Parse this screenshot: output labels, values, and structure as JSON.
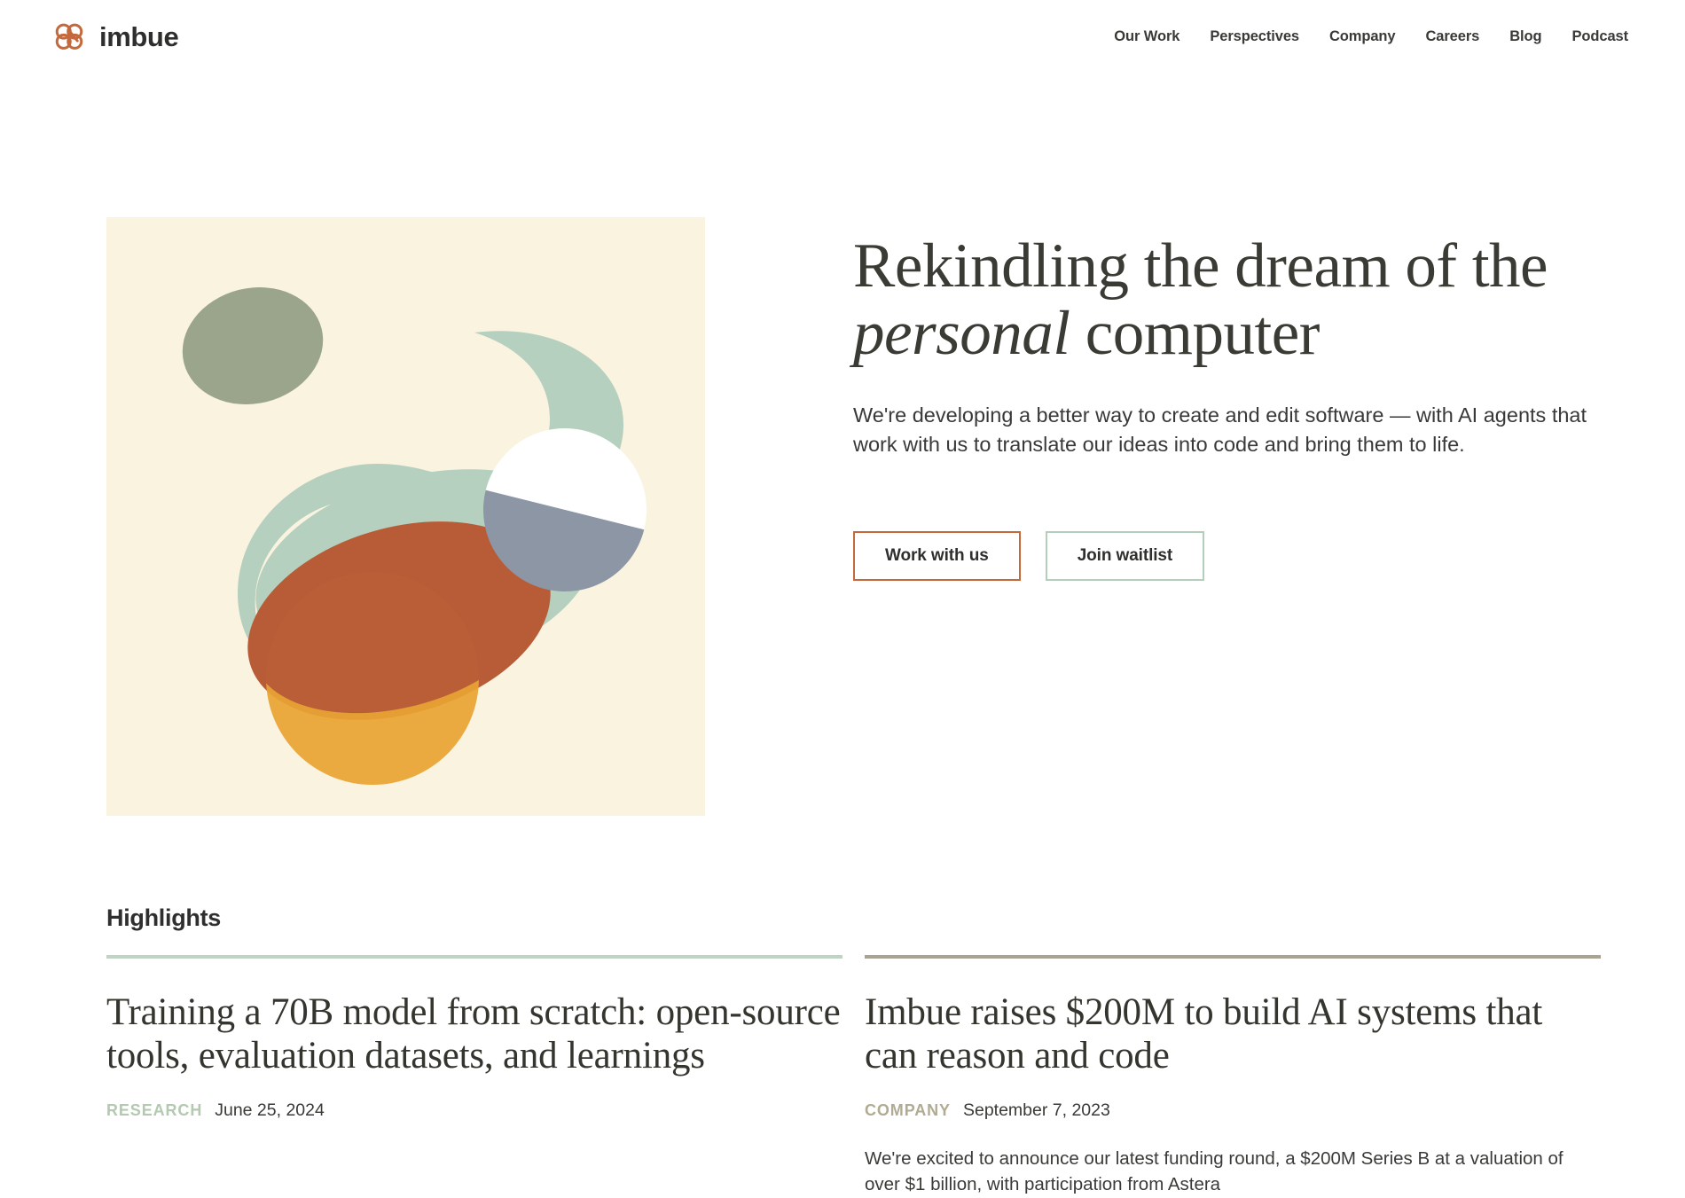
{
  "header": {
    "brand_name": "imbue",
    "brand_mark_icon": "imbue-interlocking-rings-logo",
    "brand_color": "#c4693c",
    "nav": [
      {
        "label": "Our Work"
      },
      {
        "label": "Perspectives"
      },
      {
        "label": "Company"
      },
      {
        "label": "Careers"
      },
      {
        "label": "Blog"
      },
      {
        "label": "Podcast"
      }
    ]
  },
  "hero": {
    "artwork": {
      "name": "abstract-shapes-illustration",
      "background": "#faf3e0",
      "shapes": [
        {
          "name": "sage-blob",
          "color": "#9ba58c"
        },
        {
          "name": "mint-curve",
          "color": "#b5d0be"
        },
        {
          "name": "white-circle",
          "color": "#ffffff"
        },
        {
          "name": "slate-circle",
          "color": "#8c96a5"
        },
        {
          "name": "terracotta-ellipse",
          "color": "#b85c38"
        },
        {
          "name": "amber-circle",
          "color": "#e8a433"
        }
      ]
    },
    "title_part1": "Rekindling the dream of the ",
    "title_emphasis": "personal",
    "title_part2": " computer",
    "subtitle": "We're developing a better way to create and edit software — with AI agents that work with us to translate our ideas into code and bring them to life.",
    "primary_button": "Work with us",
    "secondary_button": "Join waitlist",
    "primary_button_color": "#c4693c",
    "secondary_button_color": "#b3cfbb"
  },
  "highlights": {
    "section_title": "Highlights",
    "cards": [
      {
        "rule_color": "#bfd4c3",
        "title": "Training a 70B model from scratch: open-source tools, evaluation datasets, and learnings",
        "tag": "RESEARCH",
        "tag_color": "#b3c9b0",
        "date": "June 25, 2024",
        "excerpt": ""
      },
      {
        "rule_color": "#a9a391",
        "title": "Imbue raises $200M to build AI systems that can reason and code",
        "tag": "COMPANY",
        "tag_color": "#b0ab92",
        "date": "September 7, 2023",
        "excerpt": "We're excited to announce our latest funding round, a $200M Series B at a valuation of over $1 billion, with participation from Astera"
      }
    ]
  }
}
